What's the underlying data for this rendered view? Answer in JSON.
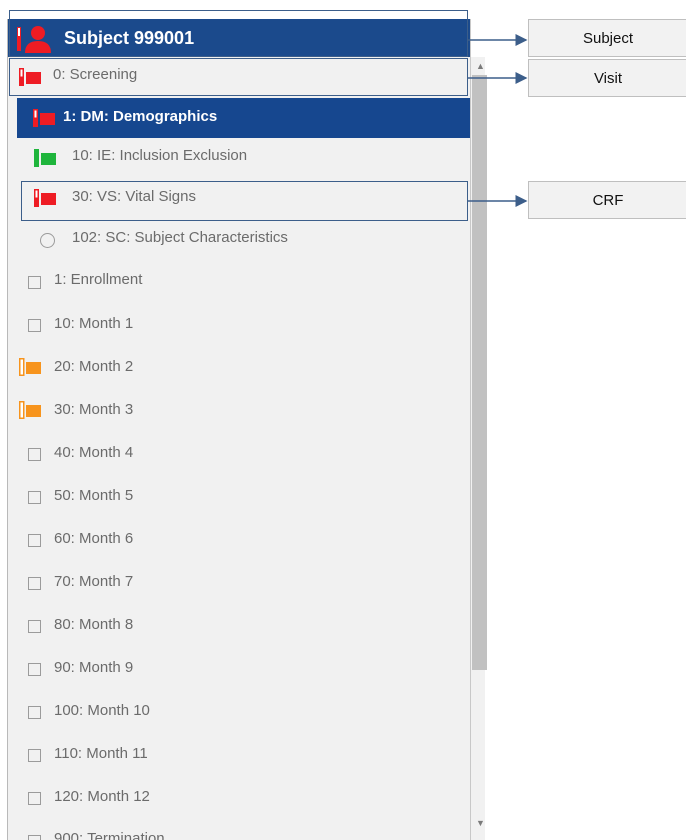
{
  "subject": {
    "title": "Subject 999001"
  },
  "visit": {
    "label": "0: Screening"
  },
  "crfs": [
    {
      "label": "1: DM: Demographics",
      "status": "red"
    },
    {
      "label": "10: IE: Inclusion Exclusion",
      "status": "green"
    },
    {
      "label": "30: VS: Vital Signs",
      "status": "red"
    },
    {
      "label": "102: SC: Subject Characteristics",
      "status": "empty"
    }
  ],
  "visits": [
    {
      "label": "1: Enrollment",
      "status": "empty"
    },
    {
      "label": "10: Month 1",
      "status": "empty"
    },
    {
      "label": "20: Month 2",
      "status": "orange"
    },
    {
      "label": "30: Month 3",
      "status": "orange"
    },
    {
      "label": "40: Month 4",
      "status": "empty"
    },
    {
      "label": "50: Month 5",
      "status": "empty"
    },
    {
      "label": "60: Month 6",
      "status": "empty"
    },
    {
      "label": "70: Month 7",
      "status": "empty"
    },
    {
      "label": "80: Month 8",
      "status": "empty"
    },
    {
      "label": "90: Month 9",
      "status": "empty"
    },
    {
      "label": "100: Month 10",
      "status": "empty"
    },
    {
      "label": "110: Month 11",
      "status": "empty"
    },
    {
      "label": "120: Month 12",
      "status": "empty"
    },
    {
      "label": "900: Termination",
      "status": "empty"
    }
  ],
  "callouts": {
    "subject": "Subject",
    "visit": "Visit",
    "crf": "CRF"
  },
  "colors": {
    "header_bg": "#1b4a8c",
    "selected_bg": "#16478f",
    "flag_red": "#ee1c24",
    "flag_green": "#1fb53c",
    "flag_orange": "#f7941d",
    "outline": "#3c5e8a"
  }
}
